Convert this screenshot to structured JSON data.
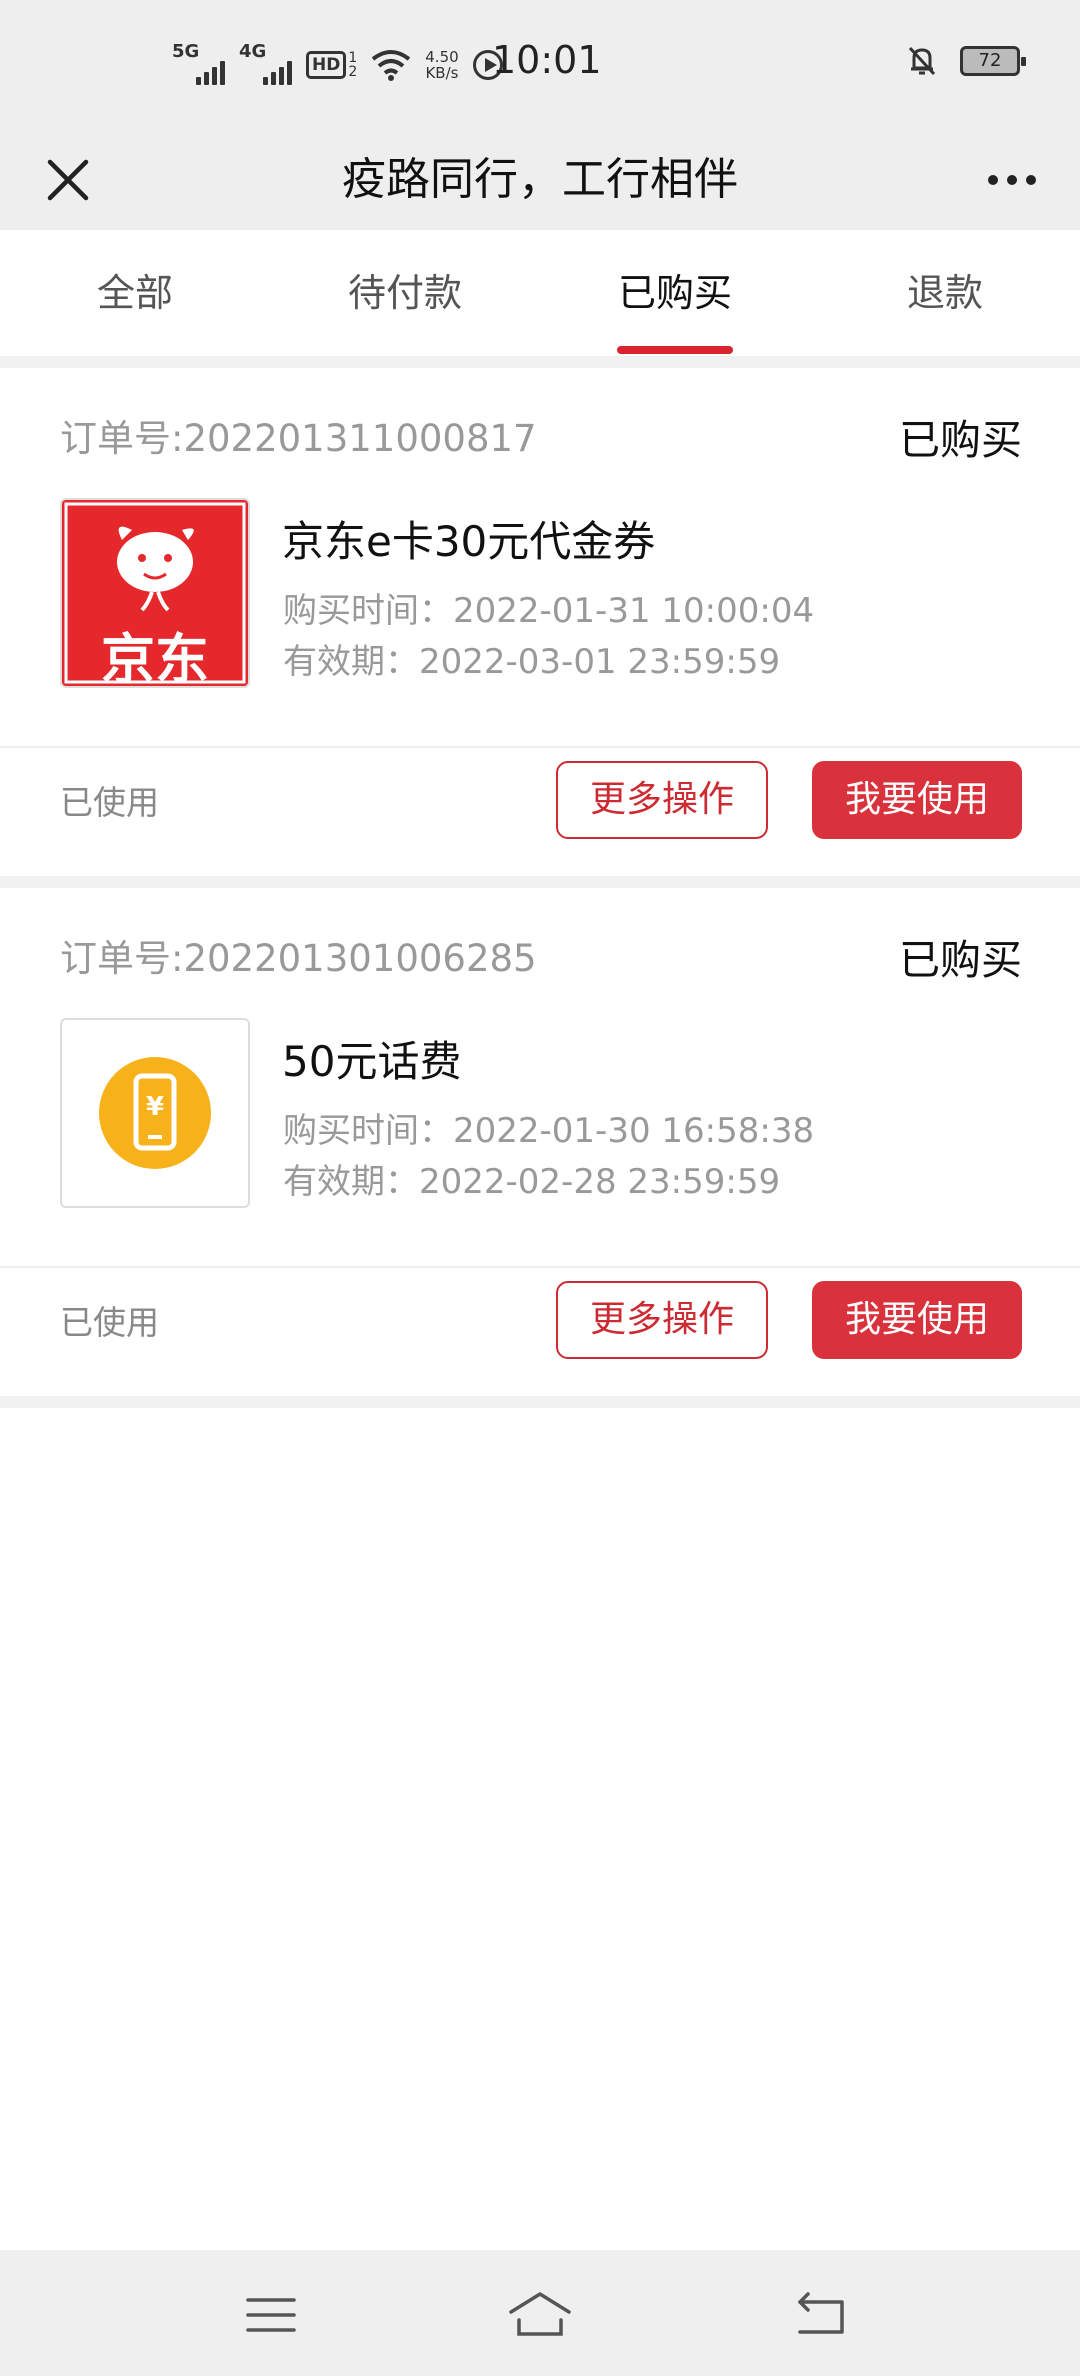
{
  "status_bar": {
    "network_5g": "5G",
    "network_4g": "4G",
    "hd_label": "HD",
    "hd_slot_top": "1",
    "hd_slot_bottom": "2",
    "speed_value": "4.50",
    "speed_unit": "KB/s",
    "time": "10:01",
    "battery_level": "72"
  },
  "header": {
    "title": "疫路同行，工行相伴",
    "close_icon": "close-icon",
    "more_icon": "more-dots-icon"
  },
  "tabs": [
    {
      "label": "全部",
      "active": false
    },
    {
      "label": "待付款",
      "active": false
    },
    {
      "label": "已购买",
      "active": true
    },
    {
      "label": "退款",
      "active": false
    }
  ],
  "orders": [
    {
      "order_no": "订单号:202201311000817",
      "status": "已购买",
      "product_title": "京东e卡30元代金券",
      "thumb_text": "京东",
      "purchase_time": "购买时间：2022-01-31 10:00:04",
      "valid_until": "有效期：2022-03-01 23:59:59",
      "usage_state": "已使用",
      "more_label": "更多操作",
      "use_label": "我要使用"
    },
    {
      "order_no": "订单号:202201301006285",
      "status": "已购买",
      "product_title": "50元话费",
      "thumb_text": "¥",
      "purchase_time": "购买时间：2022-01-30 16:58:38",
      "valid_until": "有效期：2022-02-28 23:59:59",
      "usage_state": "已使用",
      "more_label": "更多操作",
      "use_label": "我要使用"
    }
  ],
  "colors": {
    "accent": "#d9323c",
    "jd_red": "#e4282b",
    "phone_orange": "#f7b21b"
  }
}
